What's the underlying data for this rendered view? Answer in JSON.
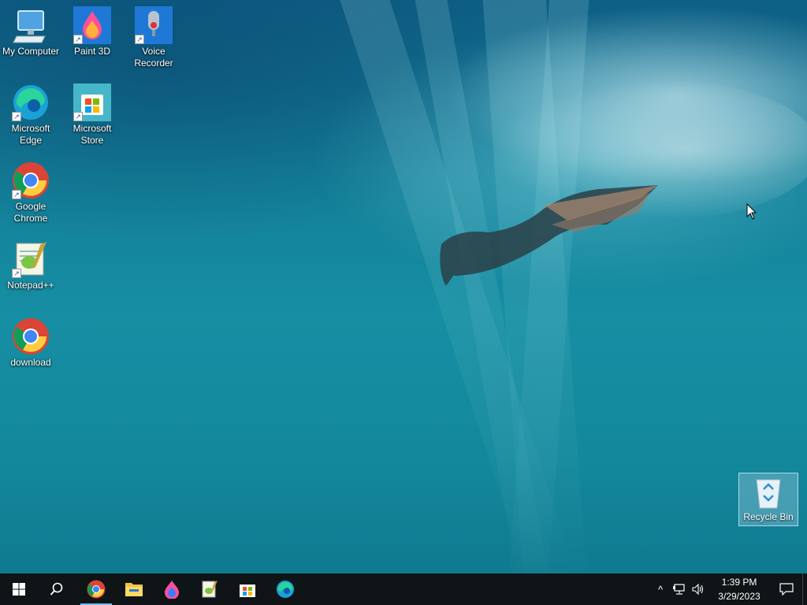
{
  "desktop": {
    "icons": [
      {
        "label": "My Computer"
      },
      {
        "label": "Paint 3D"
      },
      {
        "label": "Voice Recorder"
      },
      {
        "label": "Microsoft Edge"
      },
      {
        "label": "Microsoft Store"
      },
      {
        "label": "Google Chrome"
      },
      {
        "label": "Notepad++"
      },
      {
        "label": "download"
      }
    ],
    "recycle_bin": {
      "label": "Recycle Bin"
    }
  },
  "taskbar": {
    "pinned": [
      "start-icon",
      "search-icon",
      "chrome-icon",
      "file-explorer-icon",
      "paint-3d-icon",
      "notepad-plus-plus-icon",
      "microsoft-store-icon",
      "edge-icon"
    ],
    "accent": "#76b9ed"
  },
  "tray": {
    "chevron": "^",
    "time": "1:39 PM",
    "date": "3/29/2023"
  }
}
